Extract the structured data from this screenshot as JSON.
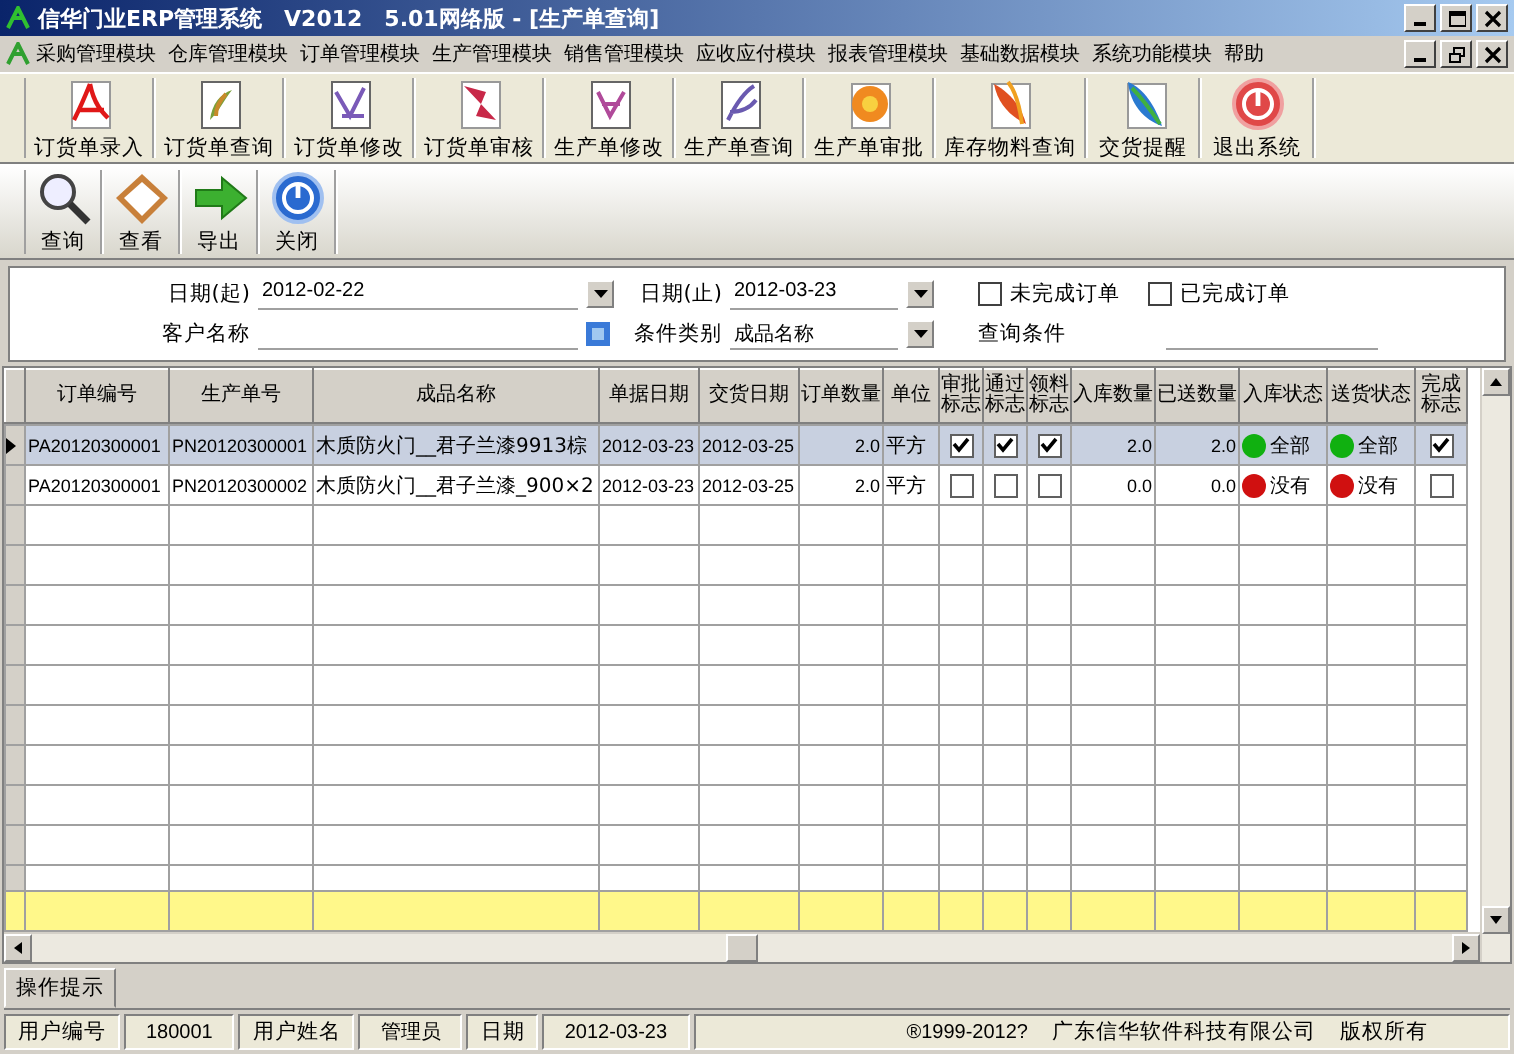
{
  "window": {
    "title": "信华门业ERP管理系统　V2012　5.01网络版 - [生产单查询]"
  },
  "menu": [
    "采购管理模块",
    "仓库管理模块",
    "订单管理模块",
    "生产管理模块",
    "销售管理模块",
    "应收应付模块",
    "报表管理模块",
    "基础数据模块",
    "系统功能模块",
    "帮助"
  ],
  "main_toolbar": [
    "订货单录入",
    "订货单查询",
    "订货单修改",
    "订货单审核",
    "生产单修改",
    "生产单查询",
    "生产单审批",
    "库存物料查询",
    "交货提醒",
    "退出系统"
  ],
  "query_toolbar": [
    "查询",
    "查看",
    "导出",
    "关闭"
  ],
  "filter": {
    "date_start": {
      "label": "日期(起)",
      "value": "2012-02-22"
    },
    "date_end": {
      "label": "日期(止)",
      "value": "2012-03-23"
    },
    "options": [
      {
        "label": "未完成订单",
        "checked": false
      },
      {
        "label": "已完成订单",
        "checked": false
      }
    ],
    "customer": {
      "label": "客户名称"
    },
    "condition_type": {
      "label": "条件类别",
      "value": "成品名称"
    },
    "condition": {
      "label": "查询条件"
    }
  },
  "table": {
    "columns": [
      "订单编号",
      "生产单号",
      "成品名称",
      "单据日期",
      "交货日期",
      "订单数量",
      "单位",
      "审批标志",
      "通过标志",
      "领料标志",
      "入库数量",
      "已送数量",
      "入库状态",
      "送货状态",
      "完成标志"
    ],
    "rows": [
      {
        "selected": true,
        "order_no": "PA20120300001",
        "production_no": "PN20120300001",
        "product_name": "木质防火门__君子兰漆9913棕",
        "doc_date": "2012-03-23",
        "delivery_date": "2012-03-25",
        "quantity": "2.0",
        "unit": "平方",
        "approved": true,
        "passed": true,
        "material": true,
        "stocked_qty": "2.0",
        "delivered_qty": "2.0",
        "stock_status": {
          "text": "全部",
          "color": "#10b010"
        },
        "delivery_status": {
          "text": "全部",
          "color": "#10b010"
        },
        "completed": true
      },
      {
        "selected": false,
        "order_no": "PA20120300001",
        "production_no": "PN20120300002",
        "product_name": "木质防火门__君子兰漆_900×2",
        "doc_date": "2012-03-23",
        "delivery_date": "2012-03-25",
        "quantity": "2.0",
        "unit": "平方",
        "approved": false,
        "passed": false,
        "material": false,
        "stocked_qty": "0.0",
        "delivered_qty": "0.0",
        "stock_status": {
          "text": "没有",
          "color": "#d01010"
        },
        "delivery_status": {
          "text": "没有",
          "color": "#d01010"
        },
        "completed": false
      }
    ]
  },
  "tip_tab": "操作提示",
  "status_bar": {
    "fields": [
      {
        "label": "用户编号",
        "value": "180001"
      },
      {
        "label": "用户姓名",
        "value": "管理员"
      },
      {
        "label": "日期",
        "value": "2012-03-23"
      }
    ],
    "copyright": "®1999-2012?",
    "company": "广东信华软件科技有限公司",
    "rights": "版权所有"
  }
}
